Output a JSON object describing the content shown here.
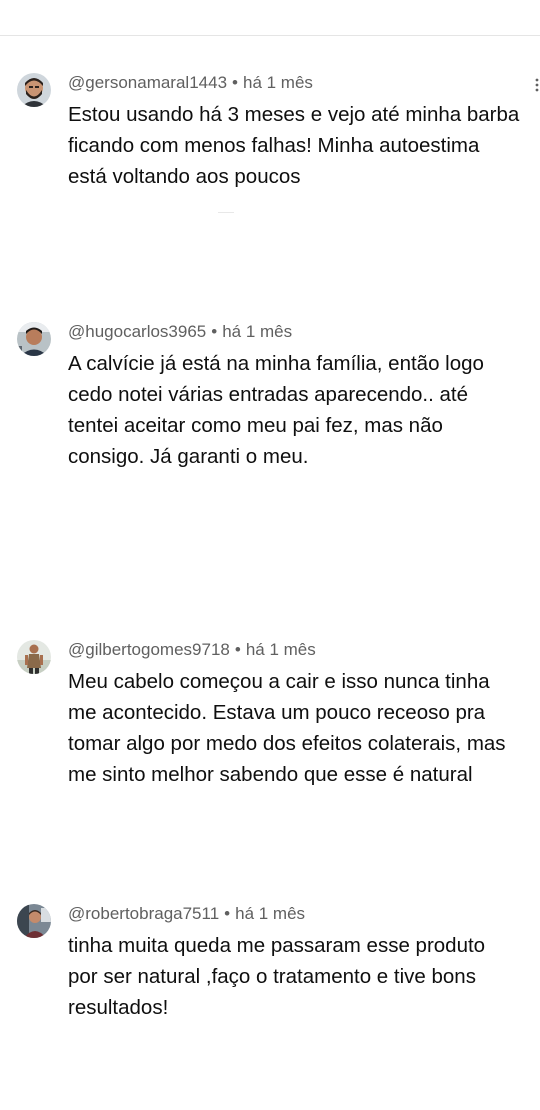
{
  "comments": [
    {
      "handle": "@gersonamaral1443",
      "separator": "•",
      "time": "há 1 mês",
      "text": "Estou usando há 3 meses e vejo até minha barba\nficando com menos falhas! Minha autoestima\nestá voltando aos poucos",
      "avatar_icon": "bearded-man-avatar"
    },
    {
      "handle": "@hugocarlos3965",
      "separator": "•",
      "time": "há 1 mês",
      "text": "A calvície já está na minha família, então logo\ncedo notei várias entradas aparecendo.. até\ntentei aceitar como meu pai fez, mas não\nconsigo. Já garanti o meu.",
      "avatar_icon": "man-in-car-avatar"
    },
    {
      "handle": "@gilbertogomes9718",
      "separator": "•",
      "time": "há 1 mês",
      "text": "Meu cabelo começou a cair e isso nunca tinha\nme acontecido. Estava um pouco receoso pra\ntomar algo por medo dos efeitos colaterais, mas\nme sinto melhor sabendo que esse é natural",
      "avatar_icon": "man-standing-avatar"
    },
    {
      "handle": "@robertobraga7511",
      "separator": "•",
      "time": "há 1 mês",
      "text": "tinha muita queda me passaram esse produto\npor ser natural ,faço o tratamento e tive bons\nresultados!",
      "avatar_icon": "man-indoor-avatar"
    }
  ],
  "colors": {
    "meta_text": "#606060",
    "body_text": "#0f0f0f",
    "divider": "#e5e5e5"
  },
  "icons": {
    "more": "vertical-dots-icon"
  }
}
